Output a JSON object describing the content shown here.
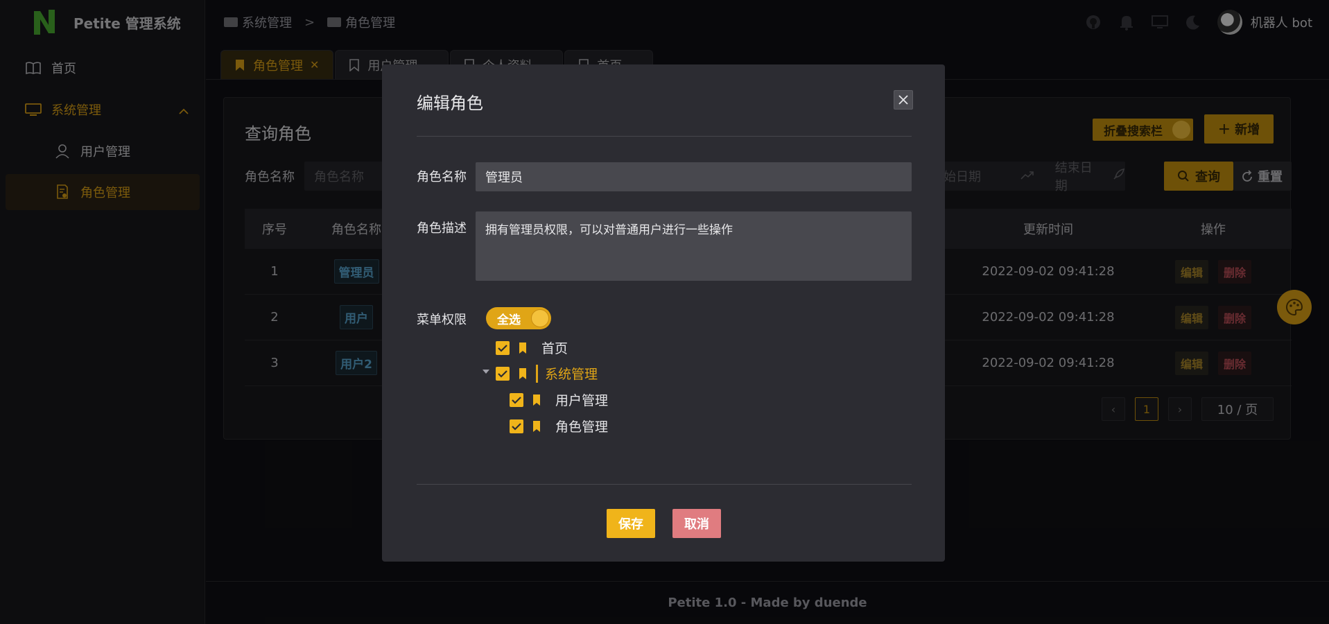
{
  "app": {
    "title": "Petite 管理系统"
  },
  "sidebar": {
    "items": [
      {
        "label": "首页",
        "icon": "book-icon"
      },
      {
        "label": "系统管理",
        "icon": "monitor-icon"
      },
      {
        "label": "用户管理",
        "icon": "user-icon"
      },
      {
        "label": "角色管理",
        "icon": "role-doc-icon"
      }
    ]
  },
  "header": {
    "breadcrumb": [
      "系统管理",
      "角色管理"
    ],
    "breadcrumb_sep": ">",
    "user_name": "机器人 bot"
  },
  "tabs": [
    {
      "label": "角色管理",
      "active": true,
      "close": "✕"
    },
    {
      "label": "用户管理",
      "active": false,
      "close": "⌄"
    },
    {
      "label": "个人资料",
      "active": false,
      "close": "⌄"
    },
    {
      "label": "首页",
      "active": false,
      "close": "⌄"
    }
  ],
  "page": {
    "title": "查询角色",
    "fold_label": "折叠搜索栏",
    "new_label": "＋ 新增",
    "search_label": "角色名称",
    "search_placeholder": "角色名称",
    "start_date_placeholder": "开始日期",
    "end_date_placeholder": "结束日期",
    "query_label": "查询",
    "reset_label": "重置"
  },
  "table": {
    "headers": {
      "idx": "序号",
      "name": "角色名称",
      "time": "更新时间",
      "ops": "操作"
    },
    "rows": [
      {
        "idx": "1",
        "name": "管理员",
        "time": "2022-09-02 09:41:28"
      },
      {
        "idx": "2",
        "name": "用户",
        "time": "2022-09-02 09:41:28"
      },
      {
        "idx": "3",
        "name": "用户2",
        "time": "2022-09-02 09:41:28"
      }
    ],
    "edit_label": "编辑",
    "delete_label": "删除"
  },
  "pager": {
    "prev": "‹",
    "page": "1",
    "next": "›",
    "size": "10 / 页"
  },
  "footer": {
    "text": "Petite 1.0 - Made by duende"
  },
  "modal": {
    "title": "编辑角色",
    "name_label": "角色名称",
    "name_value": "管理员",
    "desc_label": "角色描述",
    "desc_value": "拥有管理员权限，可以对普通用户进行一些操作",
    "perm_label": "菜单权限",
    "select_all": "全选",
    "tree": [
      {
        "label": "首页",
        "checked": true
      },
      {
        "label": "系统管理",
        "checked": true
      },
      {
        "label": "用户管理",
        "checked": true
      },
      {
        "label": "角色管理",
        "checked": true
      }
    ],
    "save_label": "保存",
    "cancel_label": "取消"
  },
  "colors": {
    "accent": "#e0a516",
    "danger": "#e07c80",
    "bg": "#101014"
  }
}
